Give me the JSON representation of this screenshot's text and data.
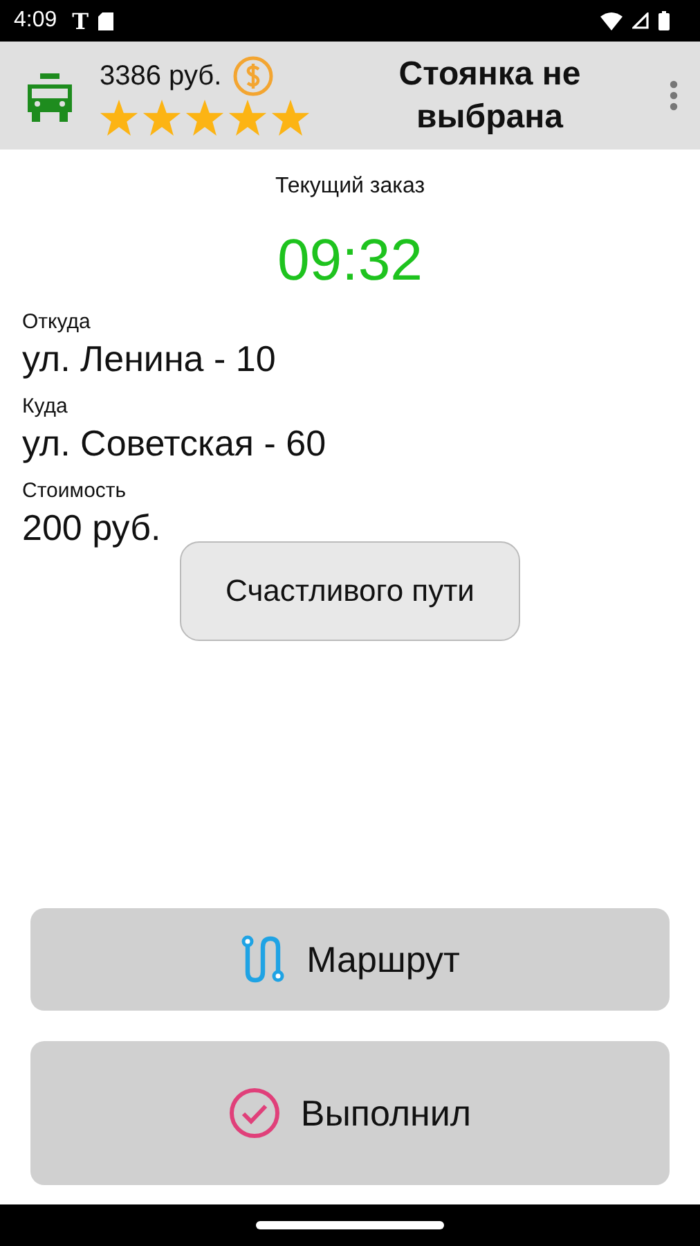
{
  "status_bar": {
    "time": "4:09",
    "carrier_glyph": "T"
  },
  "header": {
    "balance": "3386 руб.",
    "stars": 5,
    "title": "Стоянка не выбрана"
  },
  "order": {
    "heading": "Текущий заказ",
    "timer": "09:32",
    "fields": [
      {
        "label": "Откуда",
        "value": "ул. Ленина - 10"
      },
      {
        "label": "Куда",
        "value": "ул. Советская - 60"
      },
      {
        "label": "Стоимость",
        "value": "200 руб."
      }
    ],
    "wish_button": "Счастливого пути"
  },
  "actions": [
    {
      "kind": "route",
      "label": "Маршрут"
    },
    {
      "kind": "done",
      "label": "Выполнил"
    }
  ]
}
